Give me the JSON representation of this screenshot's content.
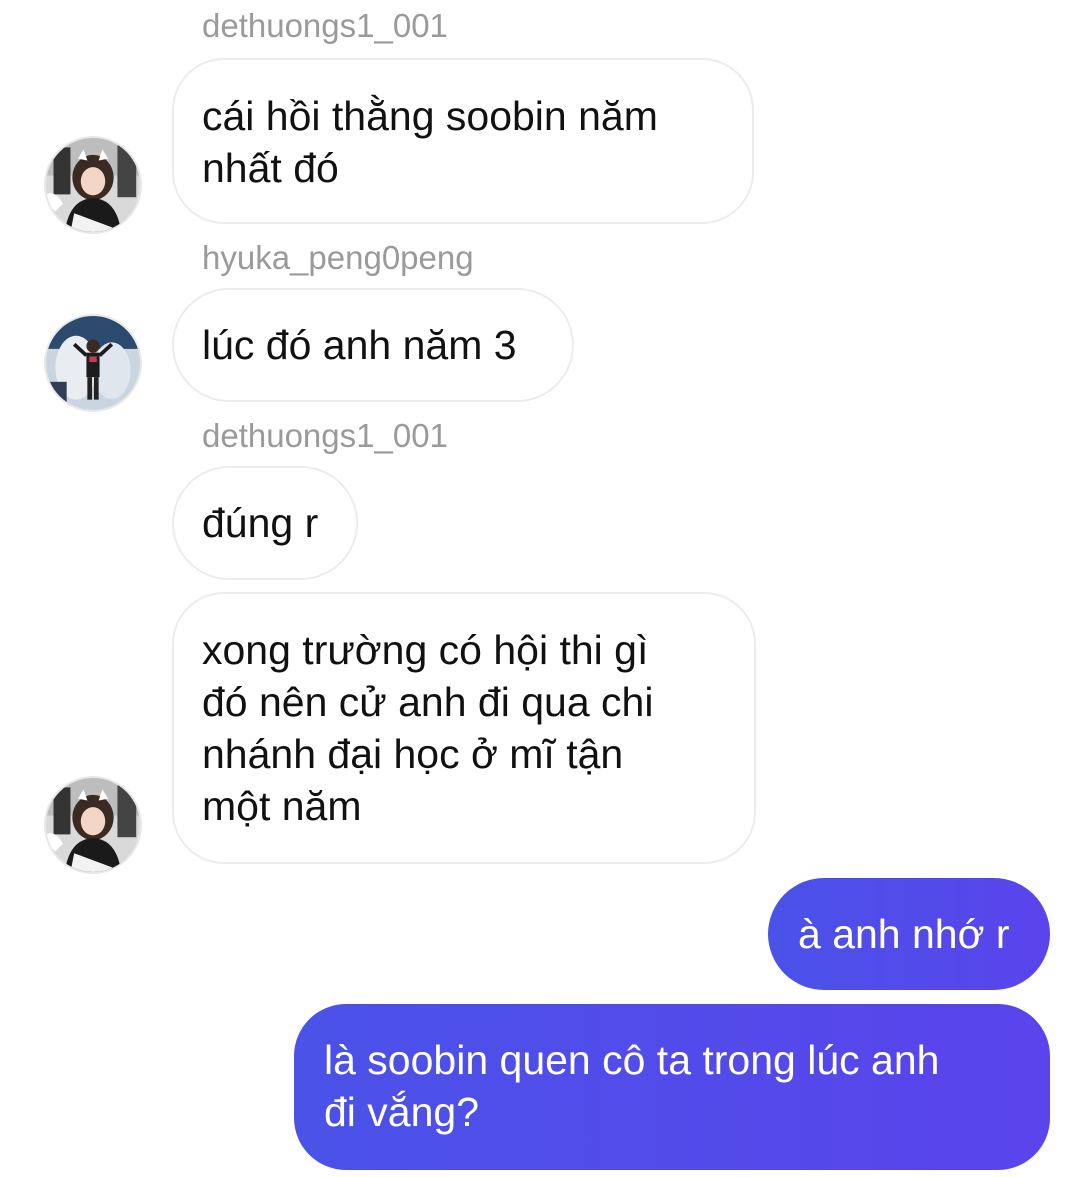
{
  "messages": [
    {
      "sender": "dethuongs1_001",
      "lines": [
        "cái hồi thằng soobin năm",
        "nhất đó"
      ]
    },
    {
      "sender": "hyuka_peng0peng",
      "lines": [
        "lúc đó anh năm 3"
      ]
    },
    {
      "sender": "dethuongs1_001",
      "lines": [
        "đúng r"
      ]
    },
    {
      "lines": [
        "xong trường có hội thi gì",
        "đó nên cử anh đi qua chi",
        "nhánh đại học ở mĩ tận",
        "một năm"
      ]
    },
    {
      "lines": [
        "à anh nhớ r"
      ]
    },
    {
      "lines": [
        "là soobin quen cô ta trong lúc anh",
        "đi vắng?"
      ]
    }
  ],
  "avatars": {
    "dethuongs1_001": "avatar-photo-girl-cat-ears",
    "hyuka_peng0peng": "avatar-photo-boy-blue-background"
  },
  "colors": {
    "outgoing_bubble_start": "#4a52e8",
    "outgoing_bubble_end": "#5a44ec",
    "incoming_border": "#ececec",
    "sender_name": "#9a9a9a"
  }
}
